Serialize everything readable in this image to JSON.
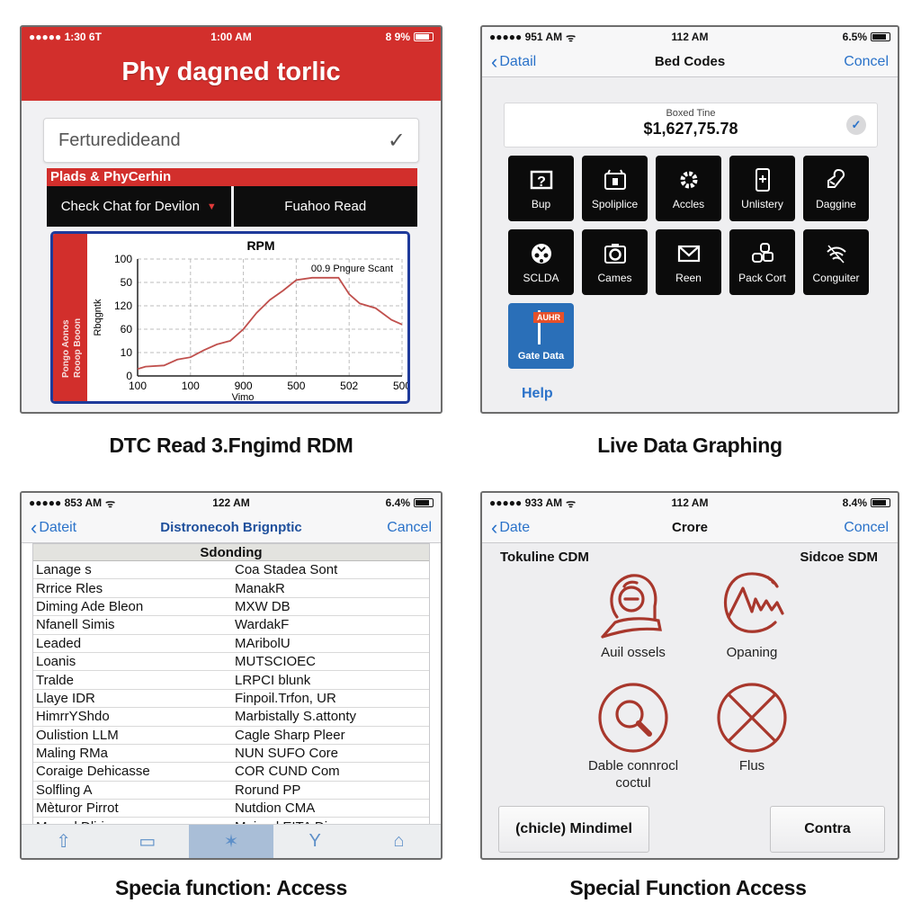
{
  "panels": {
    "dtc_read": {
      "status": {
        "left": "●●●●● 1:30 6T",
        "time": "1:00 AM",
        "right": "8 9%"
      },
      "app_title": "Phy dagned torlic",
      "select_value": "Ferturedideand",
      "section_label": "Plads & PhyCerhin",
      "buttons": [
        {
          "label": "Check Chat for Devilon",
          "icon": "caret-down-icon"
        },
        {
          "label": "Fuahoo Read"
        }
      ],
      "side_label_lines": [
        "Pongo Aonos",
        "Rooop Booon"
      ],
      "caption": "DTC Read 3.Fngimd RDM"
    },
    "live_data": {
      "status": {
        "left": "●●●●● 951 AM",
        "time": "112 AM",
        "right": "6.5%"
      },
      "nav": {
        "back": "Datail",
        "title": "Bed Codes",
        "cancel": "Concel"
      },
      "value_card": {
        "label": "Boxed Tine",
        "value": "$1,627,75.78"
      },
      "tiles": [
        {
          "label": "Bup",
          "icon": "help-box-icon"
        },
        {
          "label": "Spoliplice",
          "icon": "battery-box-icon"
        },
        {
          "label": "Accles",
          "icon": "gear-icon"
        },
        {
          "label": "Unlistery",
          "icon": "phone-plus-icon"
        },
        {
          "label": "Daggine",
          "icon": "engine-icon"
        },
        {
          "label": "SCLDA",
          "icon": "gauge-icon"
        },
        {
          "label": "Cames",
          "icon": "camera-icon"
        },
        {
          "label": "Reen",
          "icon": "mail-icon"
        },
        {
          "label": "Pack Cort",
          "icon": "link-icon"
        },
        {
          "label": "Conguiter",
          "icon": "wireless-icon"
        }
      ],
      "special_tile": {
        "label": "Gate Data",
        "flag": "AUHR",
        "color": "#2a6fb8"
      },
      "help_label": "Help",
      "caption": "Live Data Graphing"
    },
    "diagnostic_table": {
      "status": {
        "left": "●●●●● 853 AM",
        "time": "122 AM",
        "right": "6.4%"
      },
      "nav": {
        "back": "Dateit",
        "title": "Distronecoh Brignptic",
        "cancel": "Cancel"
      },
      "table_header": "Sdonding",
      "rows": [
        [
          "Lanage s",
          "Coa Stadea Sont"
        ],
        [
          "Rrrice Rles",
          "ManakR"
        ],
        [
          "Diming Ade Bleon",
          "MXW DB"
        ],
        [
          "Nfanell Simis",
          "WardakF"
        ],
        [
          "Leaded",
          "MAribolU"
        ],
        [
          "Loanis",
          "MUTSCIOEC"
        ],
        [
          "Tralde",
          "LRPCI blunk"
        ],
        [
          "Llaye IDR",
          "Finpoil.Trfon, UR"
        ],
        [
          "HimrrYShdo",
          "Marbistally S.attonty"
        ],
        [
          "Oulistion LLM",
          "Cagle Sharp Pleer"
        ],
        [
          "Maling RMa",
          "NUN SUFO Core"
        ],
        [
          "Coraige Dehicasse",
          "COR CUND Com"
        ],
        [
          "Solfling A",
          "Rorund PP"
        ],
        [
          "Mèturor Pirrot",
          "Nutdion CMA"
        ],
        [
          "Monrol Dlirie",
          "Moinod EITA Diro"
        ]
      ],
      "tabbar": [
        {
          "icon": "share-up-icon",
          "glyph": "⇧",
          "active": false
        },
        {
          "icon": "folder-icon",
          "glyph": "▭",
          "active": false
        },
        {
          "icon": "tools-icon",
          "glyph": "✶",
          "active": true
        },
        {
          "icon": "filter-icon",
          "glyph": "Y",
          "active": false
        },
        {
          "icon": "key-icon",
          "glyph": "⌂",
          "active": false
        }
      ],
      "caption": "Specia function: Access"
    },
    "special_function": {
      "status": {
        "left": "●●●●● 933 AM",
        "time": "112 AM",
        "right": "8.4%"
      },
      "nav": {
        "back": "Date",
        "title": "Crore",
        "cancel": "Concel"
      },
      "sub_left": "Tokuline CDM",
      "sub_right": "Sidcoe SDM",
      "actions": [
        {
          "label": "Auil ossels",
          "icon": "reset-user-icon"
        },
        {
          "label": "Opaning",
          "icon": "waveform-icon"
        },
        {
          "label": "Dable connrocl coctul",
          "icon": "search-circle-icon"
        },
        {
          "label": "Flus",
          "icon": "cross-circle-icon"
        }
      ],
      "accent_color": "#a8372c",
      "buttons": {
        "left": "(chicle) Mindimel",
        "right": "Contra"
      },
      "caption": "Special Function Access"
    }
  },
  "chart_data": {
    "type": "line",
    "title": "RPM",
    "annotation": "00.9 Pngure Scant",
    "xlabel": "Vimo",
    "ylabel": "Rbqgntk",
    "x_tick_labels": [
      "100",
      "100",
      "900",
      "500",
      "502",
      "500"
    ],
    "y_tick_labels": [
      "0",
      "10",
      "60",
      "120",
      "50",
      "100"
    ],
    "grid": true,
    "series": [
      {
        "name": "RPM",
        "color": "#c0504d",
        "x": [
          0,
          0.03,
          0.1,
          0.15,
          0.2,
          0.25,
          0.3,
          0.35,
          0.4,
          0.45,
          0.5,
          0.55,
          0.6,
          0.66,
          0.72,
          0.76,
          0.8,
          0.84,
          0.9,
          0.96,
          1.0
        ],
        "y": [
          0.06,
          0.08,
          0.09,
          0.14,
          0.16,
          0.22,
          0.27,
          0.3,
          0.4,
          0.54,
          0.65,
          0.73,
          0.82,
          0.84,
          0.84,
          0.84,
          0.7,
          0.62,
          0.58,
          0.48,
          0.44
        ]
      }
    ],
    "ylim": [
      0,
      1
    ],
    "xlim": [
      0,
      1
    ]
  }
}
